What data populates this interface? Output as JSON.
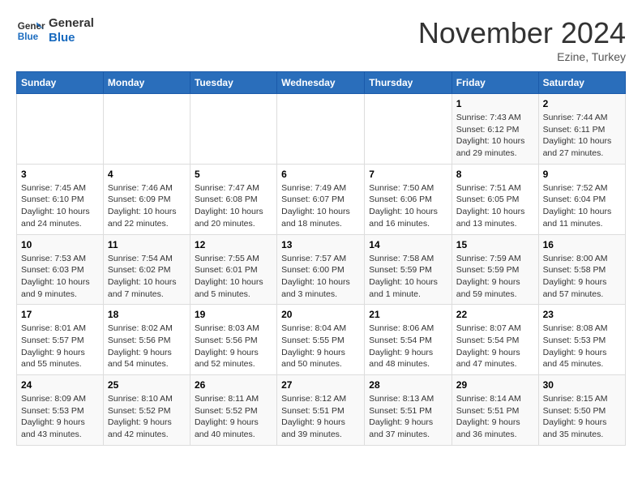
{
  "logo": {
    "line1": "General",
    "line2": "Blue"
  },
  "title": "November 2024",
  "subtitle": "Ezine, Turkey",
  "days_of_week": [
    "Sunday",
    "Monday",
    "Tuesday",
    "Wednesday",
    "Thursday",
    "Friday",
    "Saturday"
  ],
  "weeks": [
    [
      {
        "day": "",
        "info": ""
      },
      {
        "day": "",
        "info": ""
      },
      {
        "day": "",
        "info": ""
      },
      {
        "day": "",
        "info": ""
      },
      {
        "day": "",
        "info": ""
      },
      {
        "day": "1",
        "info": "Sunrise: 7:43 AM\nSunset: 6:12 PM\nDaylight: 10 hours and 29 minutes."
      },
      {
        "day": "2",
        "info": "Sunrise: 7:44 AM\nSunset: 6:11 PM\nDaylight: 10 hours and 27 minutes."
      }
    ],
    [
      {
        "day": "3",
        "info": "Sunrise: 7:45 AM\nSunset: 6:10 PM\nDaylight: 10 hours and 24 minutes."
      },
      {
        "day": "4",
        "info": "Sunrise: 7:46 AM\nSunset: 6:09 PM\nDaylight: 10 hours and 22 minutes."
      },
      {
        "day": "5",
        "info": "Sunrise: 7:47 AM\nSunset: 6:08 PM\nDaylight: 10 hours and 20 minutes."
      },
      {
        "day": "6",
        "info": "Sunrise: 7:49 AM\nSunset: 6:07 PM\nDaylight: 10 hours and 18 minutes."
      },
      {
        "day": "7",
        "info": "Sunrise: 7:50 AM\nSunset: 6:06 PM\nDaylight: 10 hours and 16 minutes."
      },
      {
        "day": "8",
        "info": "Sunrise: 7:51 AM\nSunset: 6:05 PM\nDaylight: 10 hours and 13 minutes."
      },
      {
        "day": "9",
        "info": "Sunrise: 7:52 AM\nSunset: 6:04 PM\nDaylight: 10 hours and 11 minutes."
      }
    ],
    [
      {
        "day": "10",
        "info": "Sunrise: 7:53 AM\nSunset: 6:03 PM\nDaylight: 10 hours and 9 minutes."
      },
      {
        "day": "11",
        "info": "Sunrise: 7:54 AM\nSunset: 6:02 PM\nDaylight: 10 hours and 7 minutes."
      },
      {
        "day": "12",
        "info": "Sunrise: 7:55 AM\nSunset: 6:01 PM\nDaylight: 10 hours and 5 minutes."
      },
      {
        "day": "13",
        "info": "Sunrise: 7:57 AM\nSunset: 6:00 PM\nDaylight: 10 hours and 3 minutes."
      },
      {
        "day": "14",
        "info": "Sunrise: 7:58 AM\nSunset: 5:59 PM\nDaylight: 10 hours and 1 minute."
      },
      {
        "day": "15",
        "info": "Sunrise: 7:59 AM\nSunset: 5:59 PM\nDaylight: 9 hours and 59 minutes."
      },
      {
        "day": "16",
        "info": "Sunrise: 8:00 AM\nSunset: 5:58 PM\nDaylight: 9 hours and 57 minutes."
      }
    ],
    [
      {
        "day": "17",
        "info": "Sunrise: 8:01 AM\nSunset: 5:57 PM\nDaylight: 9 hours and 55 minutes."
      },
      {
        "day": "18",
        "info": "Sunrise: 8:02 AM\nSunset: 5:56 PM\nDaylight: 9 hours and 54 minutes."
      },
      {
        "day": "19",
        "info": "Sunrise: 8:03 AM\nSunset: 5:56 PM\nDaylight: 9 hours and 52 minutes."
      },
      {
        "day": "20",
        "info": "Sunrise: 8:04 AM\nSunset: 5:55 PM\nDaylight: 9 hours and 50 minutes."
      },
      {
        "day": "21",
        "info": "Sunrise: 8:06 AM\nSunset: 5:54 PM\nDaylight: 9 hours and 48 minutes."
      },
      {
        "day": "22",
        "info": "Sunrise: 8:07 AM\nSunset: 5:54 PM\nDaylight: 9 hours and 47 minutes."
      },
      {
        "day": "23",
        "info": "Sunrise: 8:08 AM\nSunset: 5:53 PM\nDaylight: 9 hours and 45 minutes."
      }
    ],
    [
      {
        "day": "24",
        "info": "Sunrise: 8:09 AM\nSunset: 5:53 PM\nDaylight: 9 hours and 43 minutes."
      },
      {
        "day": "25",
        "info": "Sunrise: 8:10 AM\nSunset: 5:52 PM\nDaylight: 9 hours and 42 minutes."
      },
      {
        "day": "26",
        "info": "Sunrise: 8:11 AM\nSunset: 5:52 PM\nDaylight: 9 hours and 40 minutes."
      },
      {
        "day": "27",
        "info": "Sunrise: 8:12 AM\nSunset: 5:51 PM\nDaylight: 9 hours and 39 minutes."
      },
      {
        "day": "28",
        "info": "Sunrise: 8:13 AM\nSunset: 5:51 PM\nDaylight: 9 hours and 37 minutes."
      },
      {
        "day": "29",
        "info": "Sunrise: 8:14 AM\nSunset: 5:51 PM\nDaylight: 9 hours and 36 minutes."
      },
      {
        "day": "30",
        "info": "Sunrise: 8:15 AM\nSunset: 5:50 PM\nDaylight: 9 hours and 35 minutes."
      }
    ]
  ]
}
